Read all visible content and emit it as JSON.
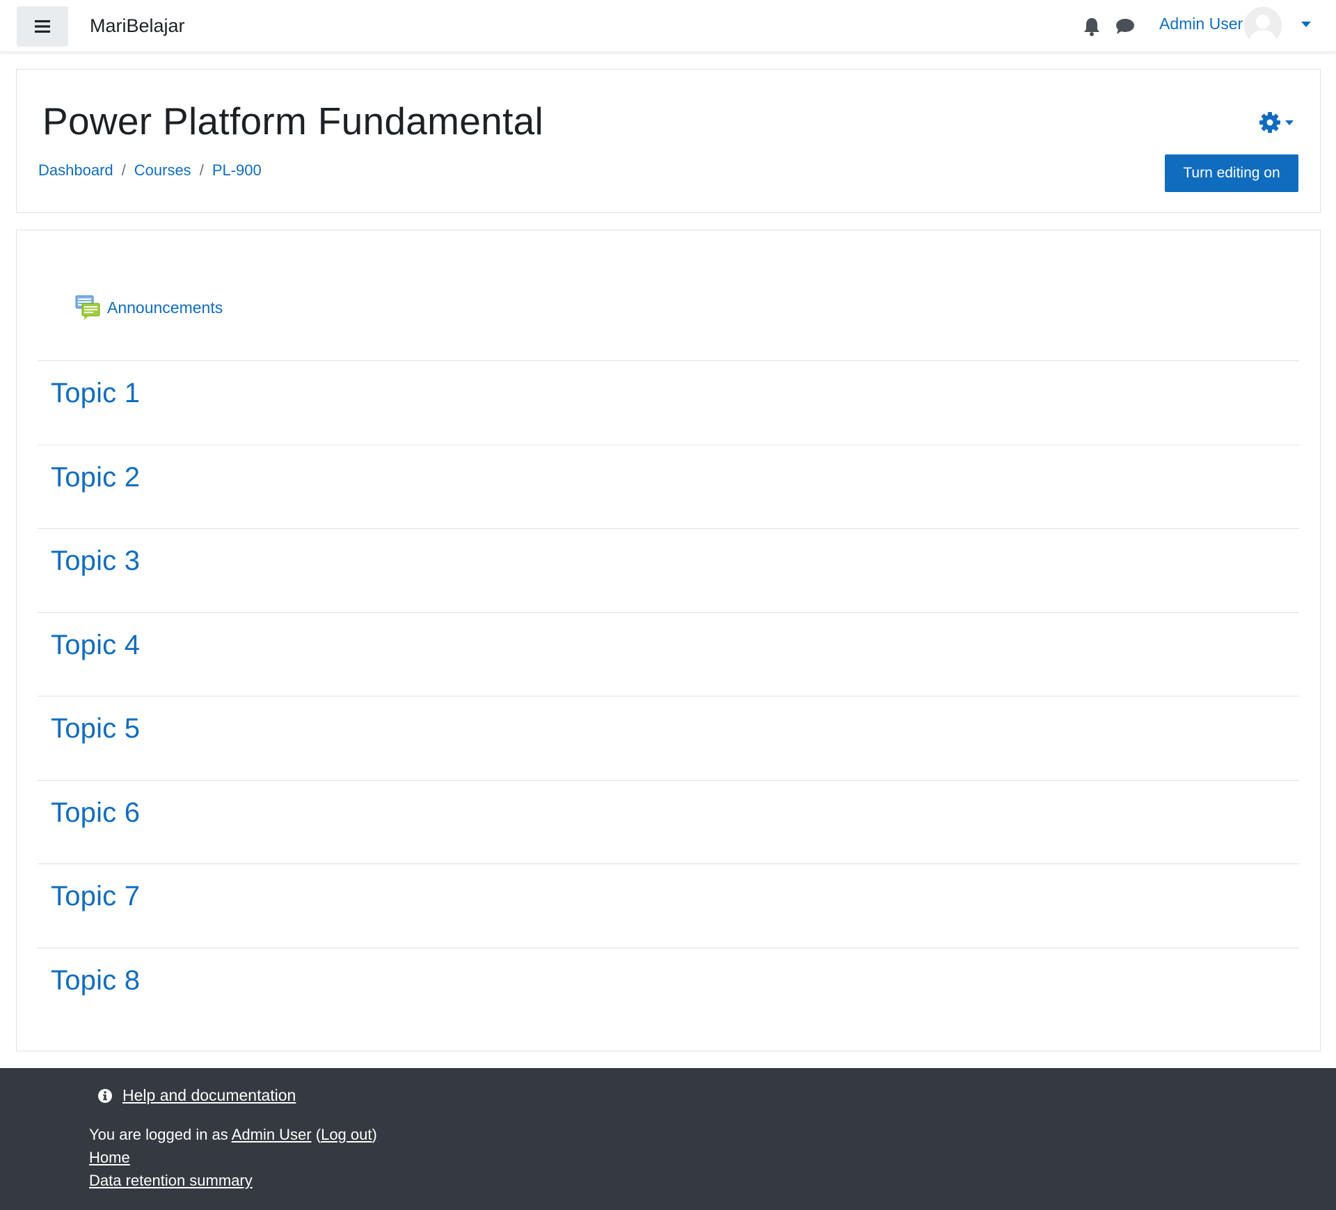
{
  "navbar": {
    "site_name": "MariBelajar",
    "user_name": "Admin User",
    "icons": [
      "hamburger-icon",
      "bell-icon",
      "chat-icon",
      "avatar-icon",
      "caret-down-icon"
    ]
  },
  "header": {
    "title": "Power Platform Fundamental",
    "breadcrumb": [
      "Dashboard",
      "Courses",
      "PL-900"
    ],
    "breadcrumb_separator": "/",
    "edit_button": "Turn editing on",
    "settings_icon": "gear-icon"
  },
  "content": {
    "announcements": "Announcements",
    "topics": [
      "Topic 1",
      "Topic 2",
      "Topic 3",
      "Topic 4",
      "Topic 5",
      "Topic 6",
      "Topic 7",
      "Topic 8"
    ]
  },
  "footer": {
    "help": "Help and documentation",
    "logged_in_prefix": "You are logged in as",
    "logged_in_user": "Admin User",
    "paren_open": " (",
    "logout": "Log out",
    "paren_close": ")",
    "home": "Home",
    "data_retention": "Data retention summary"
  },
  "colors": {
    "link": "#0f6cbf",
    "primary_button": "#0f6cbf",
    "footer_bg": "#343a40",
    "border": "#dee2e6"
  }
}
